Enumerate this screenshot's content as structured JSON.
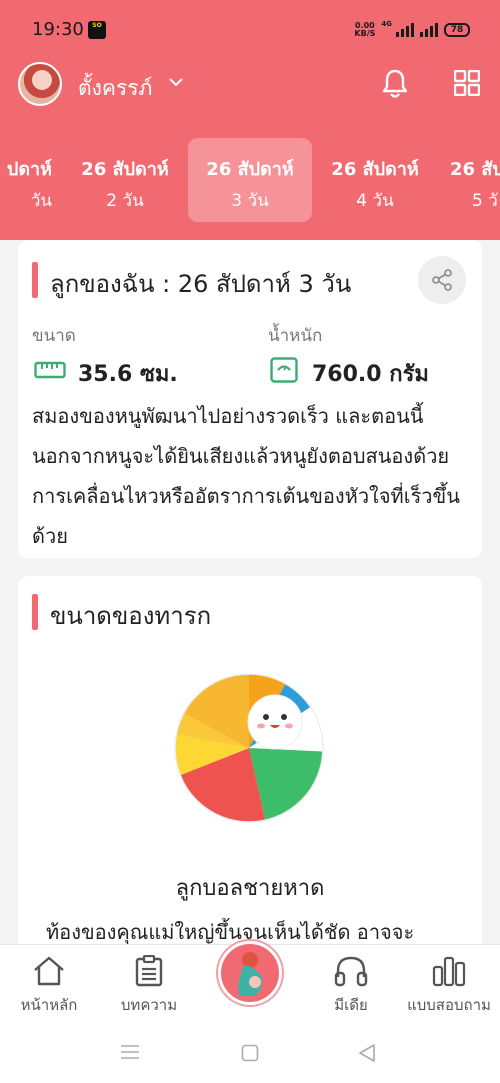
{
  "status": {
    "time": "19:30",
    "net_speed_top": "0.00",
    "net_speed_bottom": "KB/S",
    "signal_label": "4G",
    "battery": "78",
    "app_badge": "SO"
  },
  "header": {
    "username": "ตั้งครรภ์"
  },
  "tabs": [
    {
      "week": "ปดาห์",
      "day": "วัน"
    },
    {
      "week": "26 สัปดาห์",
      "day": "2 วัน"
    },
    {
      "week": "26 สัปดาห์",
      "day": "3 วัน"
    },
    {
      "week": "26 สัปดาห์",
      "day": "4 วัน"
    },
    {
      "week": "26 สัปด",
      "day": "5 วั"
    }
  ],
  "summary": {
    "title": "ลูกของฉัน : 26 สัปดาห์ 3  วัน",
    "size_label": "ขนาด",
    "size_value": "35.6 ซม.",
    "weight_label": "น้ำหนัก",
    "weight_value": "760.0 กรัม",
    "description": "สมองของหนูพัฒนาไปอย่างรวดเร็ว และตอนนี้นอกจากหนูจะได้ยินเสียงแล้วหนูยังตอบสนองด้วยการเคลื่อนไหวหรืออัตราการเต้นของหัวใจที่เร็วขึ้นด้วย"
  },
  "baby_size": {
    "title": "ขนาดของทารก",
    "object_name": "ลูกบอลชายหาด",
    "description": "ท้องของคุณแม่ใหญ่ขึ้นจนเห็นได้ชัด อาจจะ"
  },
  "nav": [
    {
      "label": "หน้าหลัก",
      "icon": "home-icon"
    },
    {
      "label": "บทความ",
      "icon": "clipboard-icon"
    },
    {
      "label": "มีเดีย",
      "icon": "headphones-icon"
    },
    {
      "label": "แบบสอบถาม",
      "icon": "bar-chart-icon"
    }
  ],
  "colors": {
    "accent": "#f16a72",
    "green": "#3dae6f"
  }
}
